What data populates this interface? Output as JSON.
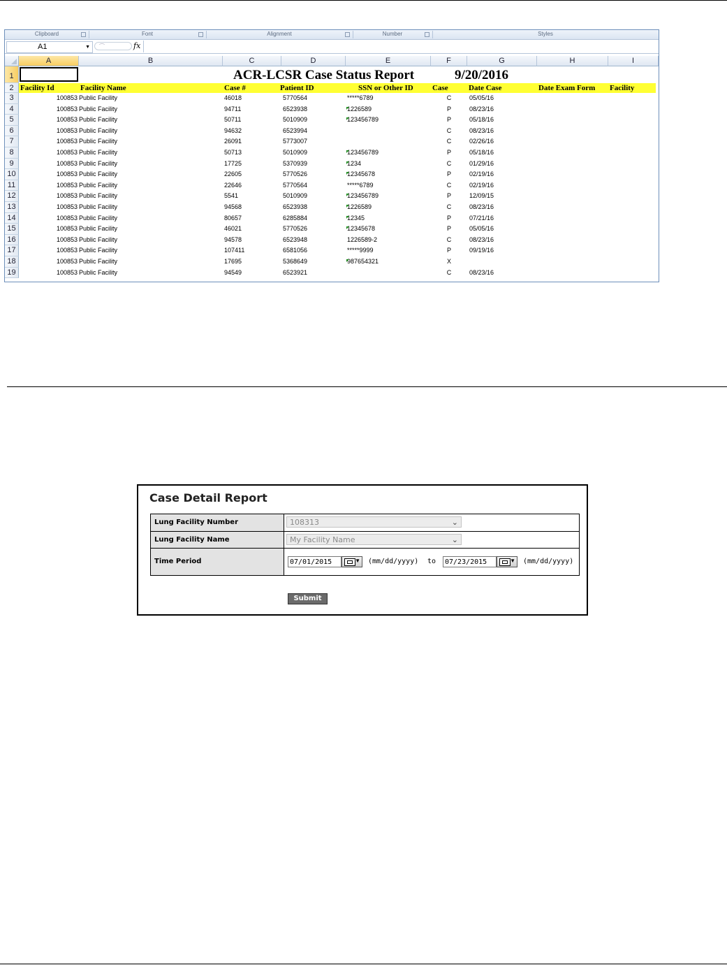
{
  "spreadsheet": {
    "ribbon_groups": [
      "Clipboard",
      "Font",
      "Alignment",
      "Number",
      "Styles"
    ],
    "name_box": "A1",
    "fx_label": "fx",
    "columns": [
      "A",
      "B",
      "C",
      "D",
      "E",
      "F",
      "G",
      "H",
      "I"
    ],
    "row_numbers": [
      "1",
      "2",
      "3",
      "4",
      "5",
      "6",
      "7",
      "8",
      "9",
      "10",
      "11",
      "12",
      "13",
      "14",
      "15",
      "16",
      "17",
      "18",
      "19"
    ],
    "title": "ACR-LCSR Case Status Report",
    "title_date": "9/20/2016",
    "headers": [
      "Facility Id",
      "Facility Name",
      "Case #",
      "Patient ID",
      "SSN or Other ID",
      "Case",
      "Date Case",
      "Date Exam Form",
      "Facility"
    ],
    "rows": [
      {
        "facility_id": "100853",
        "facility_name": "Public Facility",
        "case_no": "46018",
        "patient_id": "5770564",
        "ssn": "*****6789",
        "ssn_flag": false,
        "case": "C",
        "date_case": "05/05/16"
      },
      {
        "facility_id": "100853",
        "facility_name": "Public Facility",
        "case_no": "94711",
        "patient_id": "6523938",
        "ssn": "1226589",
        "ssn_flag": true,
        "case": "P",
        "date_case": "08/23/16"
      },
      {
        "facility_id": "100853",
        "facility_name": "Public Facility",
        "case_no": "50711",
        "patient_id": "5010909",
        "ssn": "123456789",
        "ssn_flag": true,
        "case": "P",
        "date_case": "05/18/16"
      },
      {
        "facility_id": "100853",
        "facility_name": "Public Facility",
        "case_no": "94632",
        "patient_id": "6523994",
        "ssn": "",
        "ssn_flag": false,
        "case": "C",
        "date_case": "08/23/16"
      },
      {
        "facility_id": "100853",
        "facility_name": "Public Facility",
        "case_no": "26091",
        "patient_id": "5773007",
        "ssn": "",
        "ssn_flag": false,
        "case": "C",
        "date_case": "02/26/16"
      },
      {
        "facility_id": "100853",
        "facility_name": "Public Facility",
        "case_no": "50713",
        "patient_id": "5010909",
        "ssn": "123456789",
        "ssn_flag": true,
        "case": "P",
        "date_case": "05/18/16"
      },
      {
        "facility_id": "100853",
        "facility_name": "Public Facility",
        "case_no": "17725",
        "patient_id": "5370939",
        "ssn": "1234",
        "ssn_flag": true,
        "case": "C",
        "date_case": "01/29/16"
      },
      {
        "facility_id": "100853",
        "facility_name": "Public Facility",
        "case_no": "22605",
        "patient_id": "5770526",
        "ssn": "12345678",
        "ssn_flag": true,
        "case": "P",
        "date_case": "02/19/16"
      },
      {
        "facility_id": "100853",
        "facility_name": "Public Facility",
        "case_no": "22646",
        "patient_id": "5770564",
        "ssn": "*****6789",
        "ssn_flag": false,
        "case": "C",
        "date_case": "02/19/16"
      },
      {
        "facility_id": "100853",
        "facility_name": "Public Facility",
        "case_no": "5541",
        "patient_id": "5010909",
        "ssn": "123456789",
        "ssn_flag": true,
        "case": "P",
        "date_case": "12/09/15"
      },
      {
        "facility_id": "100853",
        "facility_name": "Public Facility",
        "case_no": "94568",
        "patient_id": "6523938",
        "ssn": "1226589",
        "ssn_flag": true,
        "case": "C",
        "date_case": "08/23/16"
      },
      {
        "facility_id": "100853",
        "facility_name": "Public Facility",
        "case_no": "80657",
        "patient_id": "6285884",
        "ssn": "12345",
        "ssn_flag": true,
        "case": "P",
        "date_case": "07/21/16"
      },
      {
        "facility_id": "100853",
        "facility_name": "Public Facility",
        "case_no": "46021",
        "patient_id": "5770526",
        "ssn": "12345678",
        "ssn_flag": true,
        "case": "P",
        "date_case": "05/05/16"
      },
      {
        "facility_id": "100853",
        "facility_name": "Public Facility",
        "case_no": "94578",
        "patient_id": "6523948",
        "ssn": "1226589-2",
        "ssn_flag": false,
        "case": "C",
        "date_case": "08/23/16"
      },
      {
        "facility_id": "100853",
        "facility_name": "Public Facility",
        "case_no": "107411",
        "patient_id": "6581056",
        "ssn": "*****9999",
        "ssn_flag": false,
        "case": "P",
        "date_case": "09/19/16"
      },
      {
        "facility_id": "100853",
        "facility_name": "Public Facility",
        "case_no": "17695",
        "patient_id": "5368649",
        "ssn": "987654321",
        "ssn_flag": true,
        "case": "X",
        "date_case": ""
      },
      {
        "facility_id": "100853",
        "facility_name": "Public Facility",
        "case_no": "94549",
        "patient_id": "6523921",
        "ssn": "",
        "ssn_flag": false,
        "case": "C",
        "date_case": "08/23/16"
      }
    ]
  },
  "report_form": {
    "title": "Case Detail Report",
    "facility_number_label": "Lung Facility Number",
    "facility_number_value": "108313",
    "facility_name_label": "Lung Facility Name",
    "facility_name_value": "My Facility Name",
    "time_period_label": "Time Period",
    "from_date": "07/01/2015",
    "to_date": "07/23/2015",
    "date_format": "(mm/dd/yyyy)",
    "to_word": "to",
    "submit_label": "Submit"
  }
}
